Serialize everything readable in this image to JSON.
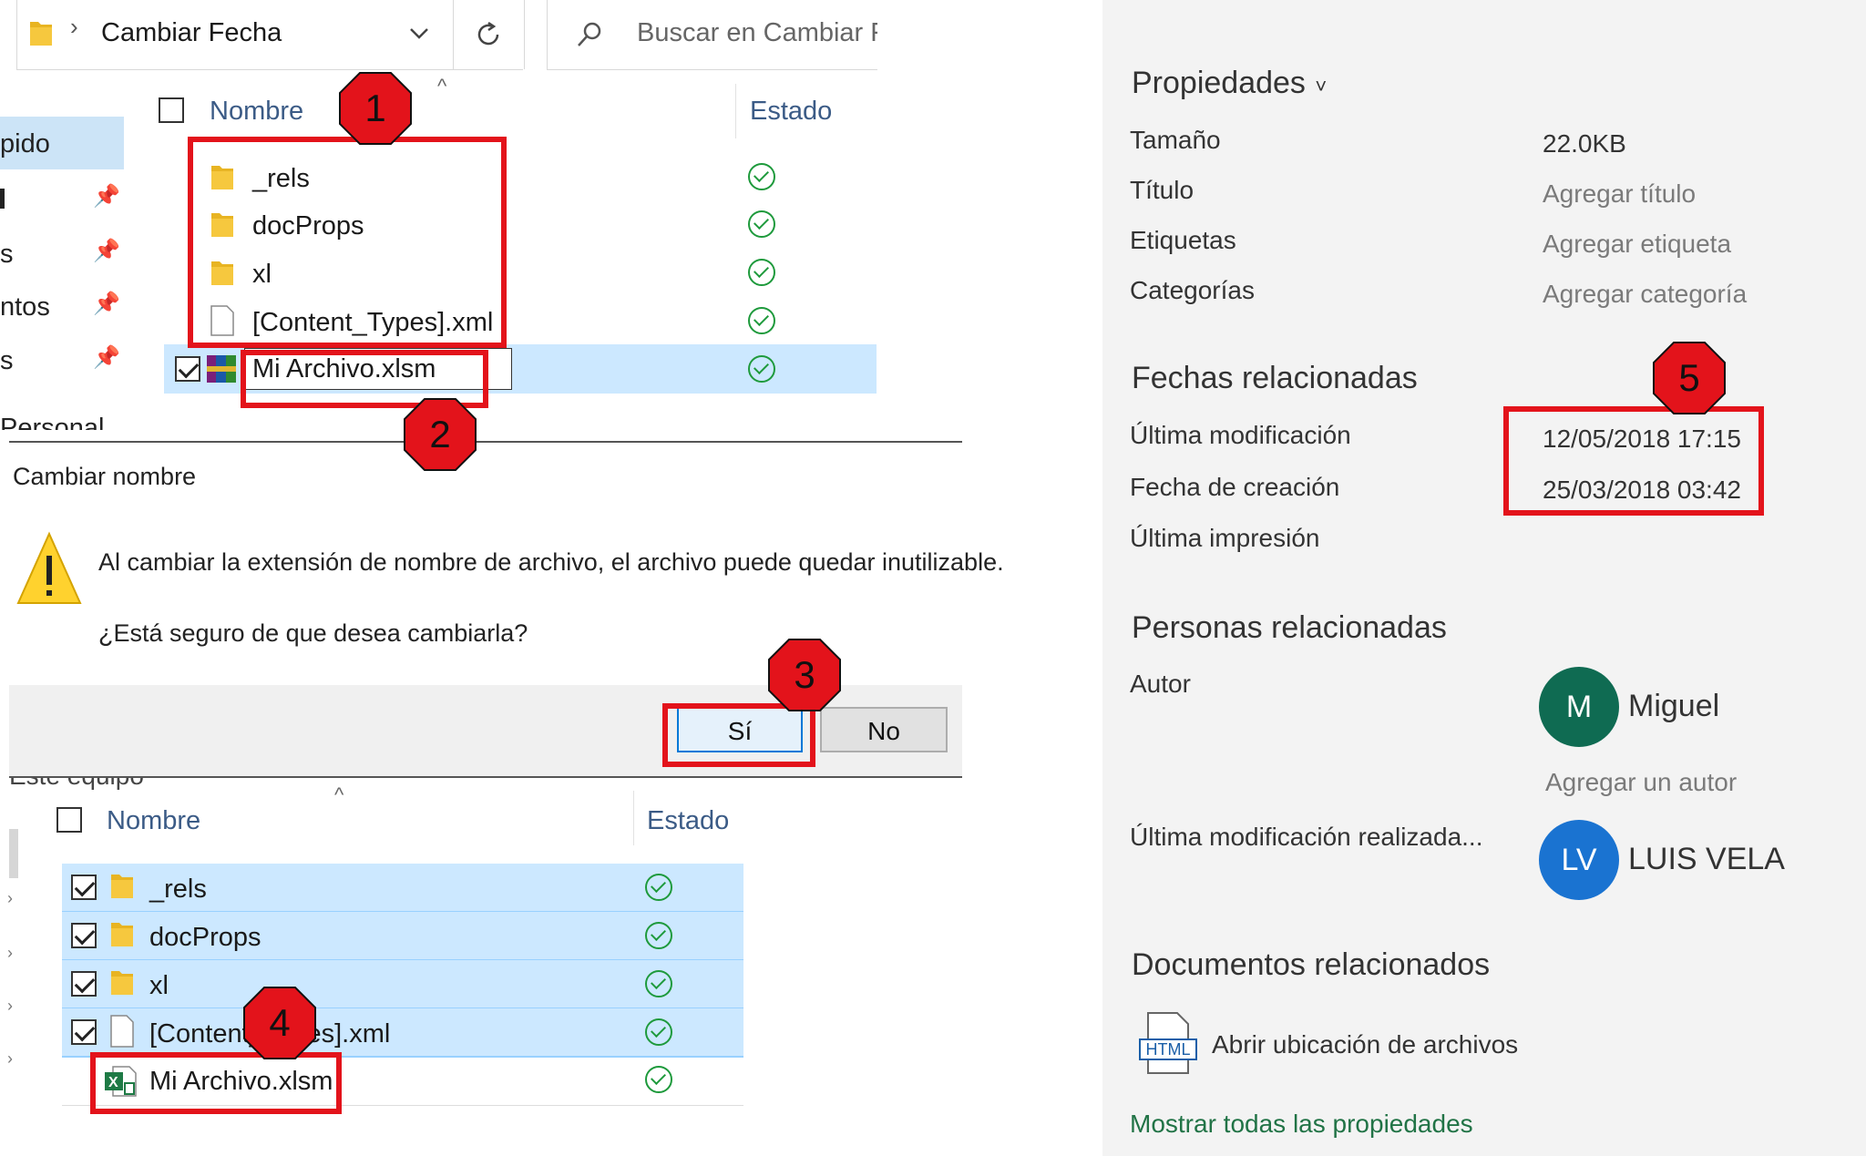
{
  "explorer_top": {
    "breadcrumb": "Cambiar Fecha",
    "search_placeholder": "Buscar en Cambiar Fecha",
    "search_visible": "Buscar en Cambiar Fe",
    "col_name": "Nombre",
    "col_status": "Estado",
    "nav_items": [
      "pido",
      "",
      "s",
      "ntos",
      "s"
    ],
    "nav_cut": "Personal",
    "files": [
      {
        "name": "_rels",
        "type": "folder"
      },
      {
        "name": "docProps",
        "type": "folder"
      },
      {
        "name": "xl",
        "type": "folder"
      },
      {
        "name": "[Content_Types].xml",
        "type": "file"
      }
    ],
    "rename_value": "Mi Archivo.xlsm"
  },
  "dialog": {
    "title": "Cambiar nombre",
    "message": "Al cambiar la extensión de nombre de archivo, el archivo puede quedar inutilizable.",
    "question": "¿Está seguro de que desea cambiarla?",
    "yes_label": "Sí",
    "no_label": "No",
    "behind_text": "Este equipo"
  },
  "explorer_bottom": {
    "col_name": "Nombre",
    "col_status": "Estado",
    "files": [
      {
        "name": "_rels",
        "type": "folder"
      },
      {
        "name": "docProps",
        "type": "folder"
      },
      {
        "name": "xl",
        "type": "folder"
      },
      {
        "name": "[Content_Types].xml",
        "type": "file"
      },
      {
        "name": "Mi Archivo.xlsm",
        "type": "excel"
      }
    ]
  },
  "annotations": [
    "1",
    "2",
    "3",
    "4",
    "5"
  ],
  "annotation_color": "#e3131b",
  "properties": {
    "title": "Propiedades",
    "rows": [
      {
        "label": "Tamaño",
        "value": "22.0KB"
      },
      {
        "label": "Título",
        "value": "Agregar título"
      },
      {
        "label": "Etiquetas",
        "value": "Agregar etiqueta"
      },
      {
        "label": "Categorías",
        "value": "Agregar categoría"
      }
    ],
    "dates_title": "Fechas relacionadas",
    "dates": [
      {
        "label": "Última modificación",
        "value": "12/05/2018 17:15"
      },
      {
        "label": "Fecha de creación",
        "value": "25/03/2018 03:42"
      },
      {
        "label": "Última impresión",
        "value": ""
      }
    ],
    "people_title": "Personas relacionadas",
    "author_label": "Autor",
    "author_initial": "M",
    "author_name": "Miguel",
    "author_color": "#0f6b52",
    "add_author": "Agregar un autor",
    "last_modified_by_label": "Última modificación realizada...",
    "modifier_initials": "LV",
    "modifier_name": "LUIS VELA",
    "modifier_color": "#1a73d1",
    "docs_title": "Documentos relacionados",
    "html_icon_text": "HTML",
    "open_location": "Abrir ubicación de archivos",
    "show_all": "Mostrar todas las propiedades"
  }
}
